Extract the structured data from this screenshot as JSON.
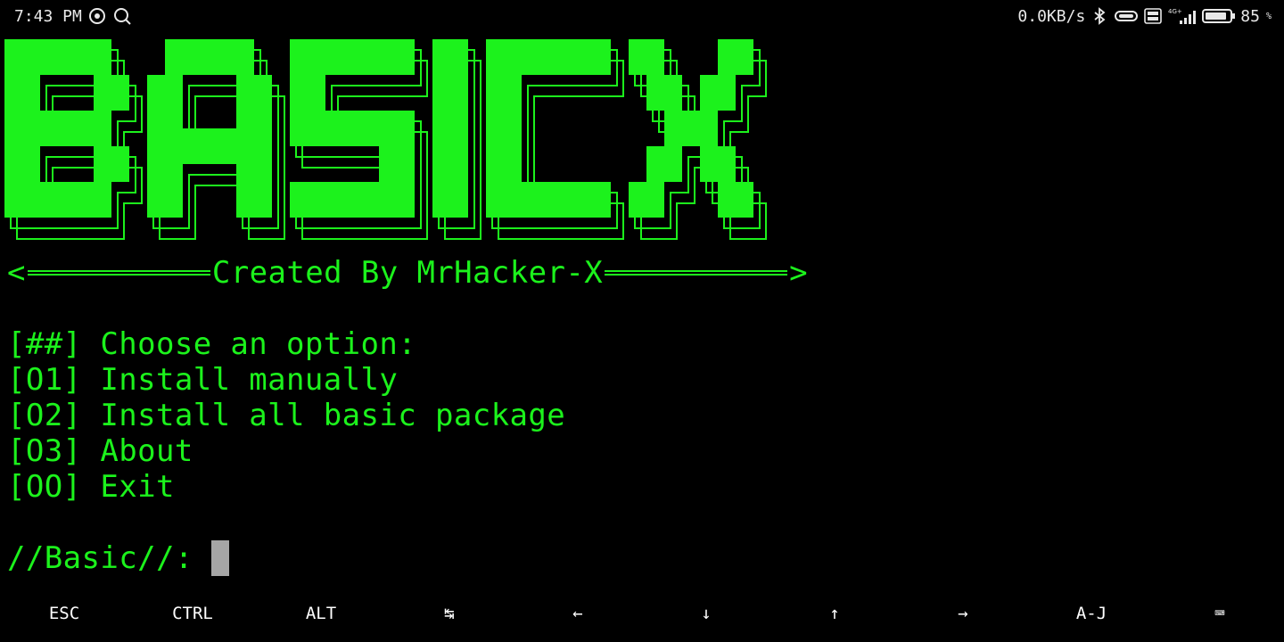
{
  "status_bar": {
    "time": "7:43 PM",
    "net_speed": "0.0KB/s",
    "network_label": "4G+",
    "battery_level": "85",
    "battery_unit": "%"
  },
  "banner": {
    "ascii_art_text": "BASICX",
    "color": "#1cf21c"
  },
  "terminal": {
    "credit_left": "<",
    "credit_text": "Created By MrHacker-X",
    "credit_right": ">",
    "menu_header": "[##] Choose an option:",
    "options": [
      "[O1] Install manually",
      "[O2] Install all basic package",
      "[O3] About",
      "[OO] Exit"
    ],
    "prompt": "//Basic//:"
  },
  "extra_keys": [
    "ESC",
    "CTRL",
    "ALT",
    "↹",
    "←",
    "↓",
    "↑",
    "→",
    "A-J",
    "⌨"
  ],
  "colors": {
    "text": "#1cf21c",
    "background": "#000000",
    "cursor": "#a6a6a6"
  }
}
